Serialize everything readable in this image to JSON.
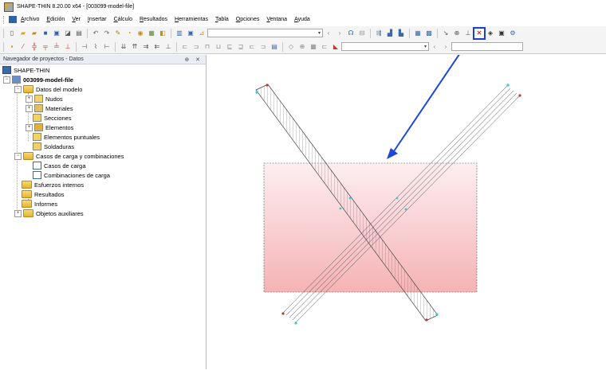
{
  "window": {
    "title": "SHAPE-THIN 8.20.00 x64 - [003099-model-file]"
  },
  "menu": {
    "items": [
      "Archivo",
      "Edición",
      "Ver",
      "Insertar",
      "Cálculo",
      "Resultados",
      "Herramientas",
      "Tabla",
      "Opciones",
      "Ventana",
      "Ayuda"
    ]
  },
  "navigator": {
    "header": "Navegador de proyectos - Datos",
    "header_controls": "⊕ ✕",
    "root": "SHAPE-THIN",
    "file": "003099-model-file",
    "model_data": "Datos del modelo",
    "nodes": "Nudos",
    "materials": "Materiales",
    "sections": "Secciones",
    "elements": "Elementos",
    "point_elements": "Elementos puntuales",
    "welds": "Soldaduras",
    "load_cases_combos": "Casos de carga y combinaciones",
    "load_cases": "Casos de carga",
    "load_combinations": "Combinaciones de carga",
    "internal_forces": "Esfuerzos internos",
    "results": "Resultados",
    "reports": "Informes",
    "aux_objects": "Objetos auxiliares"
  },
  "colors": {
    "highlight": "#1c3fcf",
    "arrow": "#1f47d6",
    "rect_fill_top": "#fdeef0",
    "rect_fill_bottom": "#f5b3b5"
  }
}
